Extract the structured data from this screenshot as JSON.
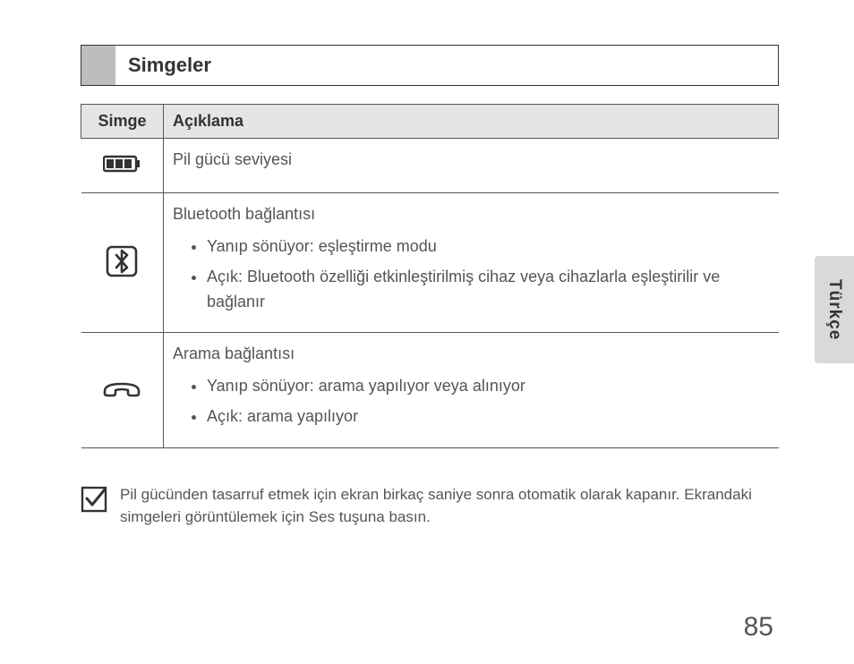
{
  "section_title": "Simgeler",
  "table": {
    "headers": {
      "icon": "Simge",
      "desc": "Açıklama"
    },
    "rows": [
      {
        "icon_name": "battery-icon",
        "desc_title": "Pil gücü seviyesi",
        "bullets": []
      },
      {
        "icon_name": "bluetooth-icon",
        "desc_title": "Bluetooth bağlantısı",
        "bullets": [
          "Yanıp sönüyor: eşleştirme modu",
          "Açık: Bluetooth özelliği etkinleştirilmiş cihaz veya cihazlarla eşleştirilir ve bağlanır"
        ]
      },
      {
        "icon_name": "phone-icon",
        "desc_title": "Arama bağlantısı",
        "bullets": [
          "Yanıp sönüyor: arama yapılıyor veya alınıyor",
          "Açık: arama yapılıyor"
        ]
      }
    ]
  },
  "note_text": "Pil gücünden tasarruf etmek için ekran birkaç saniye sonra otomatik olarak kapanır. Ekrandaki simgeleri görüntülemek için Ses tuşuna basın.",
  "lang_tab": "Türkçe",
  "page_number": "85"
}
